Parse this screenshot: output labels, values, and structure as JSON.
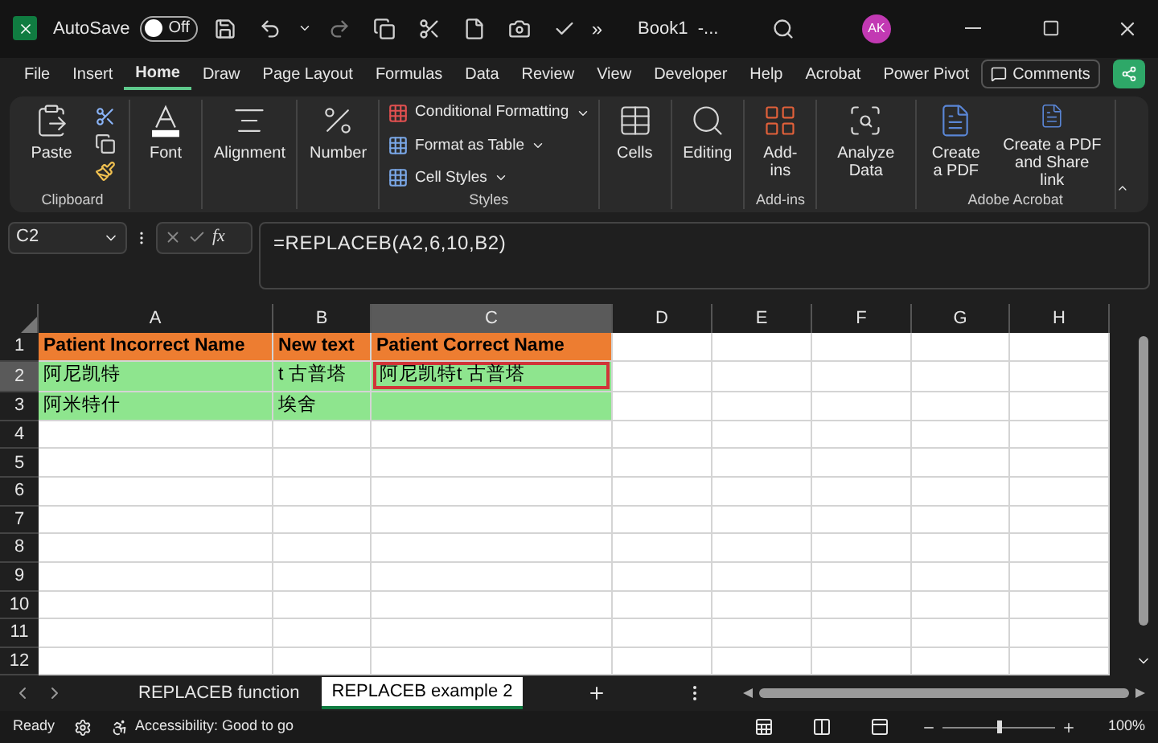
{
  "title_bar": {
    "autosave": {
      "label": "AutoSave",
      "on": false,
      "state_text": "Off"
    },
    "overflow": "»",
    "document_title": "Book1  -...",
    "avatar": "AK"
  },
  "menu_tabs": [
    {
      "label": "File",
      "selected": false
    },
    {
      "label": "Insert",
      "selected": false
    },
    {
      "label": "Home",
      "selected": true
    },
    {
      "label": "Draw",
      "selected": false
    },
    {
      "label": "Page Layout",
      "selected": false
    },
    {
      "label": "Formulas",
      "selected": false
    },
    {
      "label": "Data",
      "selected": false
    },
    {
      "label": "Review",
      "selected": false
    },
    {
      "label": "View",
      "selected": false
    },
    {
      "label": "Developer",
      "selected": false
    },
    {
      "label": "Help",
      "selected": false
    },
    {
      "label": "Acrobat",
      "selected": false
    },
    {
      "label": "Power Pivot",
      "selected": false
    }
  ],
  "comments_button": "Comments",
  "ribbon": {
    "groups": [
      {
        "label": "Clipboard",
        "items": [
          {
            "kind": "large",
            "label": "Paste"
          },
          {
            "kind": "tools"
          }
        ]
      },
      {
        "items": [
          {
            "kind": "large",
            "label": "Font"
          }
        ]
      },
      {
        "items": [
          {
            "kind": "large",
            "label": "Alignment"
          }
        ]
      },
      {
        "items": [
          {
            "kind": "large",
            "label": "Number"
          }
        ]
      },
      {
        "label": "Styles",
        "items": [
          {
            "kind": "small",
            "label": "Conditional Formatting"
          },
          {
            "kind": "small",
            "label": "Format as Table"
          },
          {
            "kind": "small",
            "label": "Cell Styles"
          }
        ]
      },
      {
        "items": [
          {
            "kind": "large",
            "label": "Cells"
          }
        ]
      },
      {
        "items": [
          {
            "kind": "large",
            "label": "Editing"
          }
        ]
      },
      {
        "label": "Add-ins",
        "items": [
          {
            "kind": "large",
            "label": "Add-ins"
          }
        ]
      },
      {
        "items": [
          {
            "kind": "large",
            "label": "Analyze Data"
          }
        ]
      },
      {
        "label": "Adobe Acrobat",
        "items": [
          {
            "kind": "large",
            "label": "Create a PDF"
          },
          {
            "kind": "large",
            "label": "Create a PDF and Share link"
          }
        ]
      }
    ]
  },
  "formula_bar": {
    "name_box": "C2",
    "function_label": "fx",
    "formula": "=REPLACEB(A2,6,10,B2)"
  },
  "sheet": {
    "columns": [
      {
        "label": "A",
        "selected": false
      },
      {
        "label": "B",
        "selected": false
      },
      {
        "label": "C",
        "selected": true
      },
      {
        "label": "D",
        "selected": false
      },
      {
        "label": "E",
        "selected": false
      },
      {
        "label": "F",
        "selected": false
      },
      {
        "label": "G",
        "selected": false
      },
      {
        "label": "H",
        "selected": false
      }
    ],
    "rows": [
      {
        "number": "1",
        "selected": false,
        "kind": "header",
        "cells": [
          {
            "text": "Patient Incorrect Name",
            "selected": false
          },
          {
            "text": "New text",
            "selected": false
          },
          {
            "text": "Patient Correct Name",
            "selected": false
          }
        ]
      },
      {
        "number": "2",
        "selected": true,
        "kind": "data",
        "cells": [
          {
            "text": "阿尼凯特",
            "selected": false
          },
          {
            "text": "t 古普塔",
            "selected": false
          },
          {
            "text": "阿尼凯特t 古普塔",
            "selected": true
          }
        ]
      },
      {
        "number": "3",
        "selected": false,
        "kind": "data",
        "cells": [
          {
            "text": "阿米特什",
            "selected": false
          },
          {
            "text": "埃舍",
            "selected": false
          },
          {
            "selected": false
          }
        ]
      },
      {
        "number": "4",
        "selected": false,
        "kind": "empty",
        "cells": []
      },
      {
        "number": "5",
        "selected": false,
        "kind": "empty",
        "cells": []
      },
      {
        "number": "6",
        "selected": false,
        "kind": "empty",
        "cells": []
      },
      {
        "number": "7",
        "selected": false,
        "kind": "empty",
        "cells": []
      },
      {
        "number": "8",
        "selected": false,
        "kind": "empty",
        "cells": []
      },
      {
        "number": "9",
        "selected": false,
        "kind": "empty",
        "cells": []
      },
      {
        "number": "10",
        "selected": false,
        "kind": "empty",
        "cells": []
      },
      {
        "number": "11",
        "selected": false,
        "kind": "empty",
        "cells": []
      },
      {
        "number": "12",
        "selected": false,
        "kind": "empty",
        "cells": []
      }
    ]
  },
  "sheet_tabs": [
    {
      "label": "REPLACEB function",
      "selected": false
    },
    {
      "label": "REPLACEB example 2",
      "selected": true
    }
  ],
  "status_bar": {
    "status": "Ready",
    "accessibility": "Accessibility: Good to go",
    "zoom": {
      "level": 0.5,
      "reading": "100%"
    }
  }
}
